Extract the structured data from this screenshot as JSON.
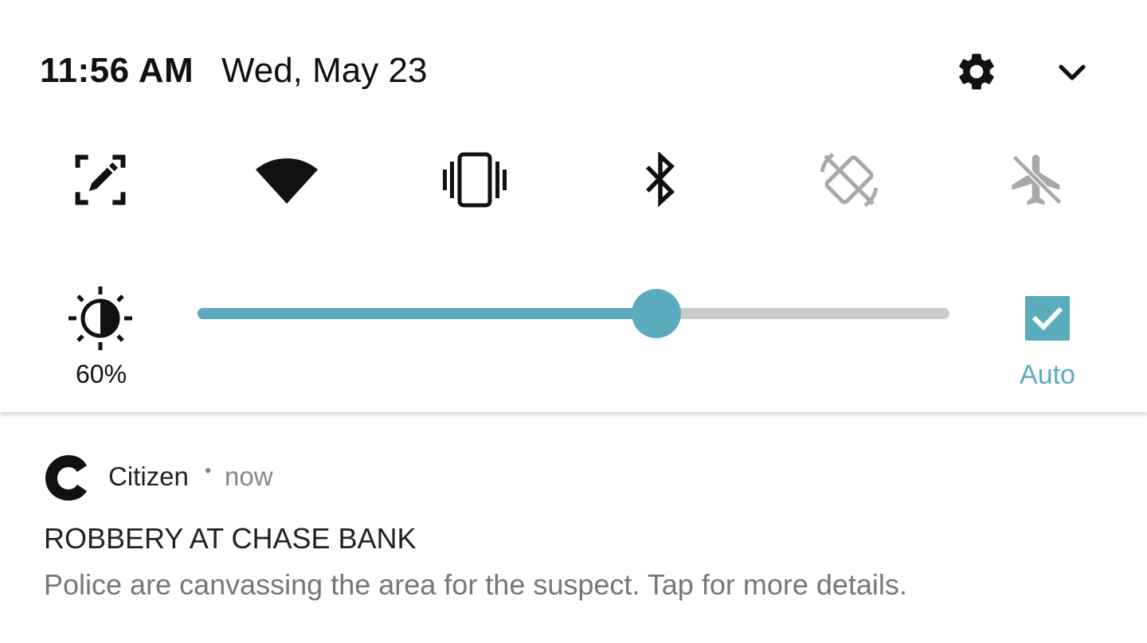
{
  "header": {
    "time": "11:56 AM",
    "date": "Wed, May 23",
    "settings_icon": "gear-icon",
    "expand_icon": "chevron-down-icon"
  },
  "tiles": [
    {
      "icon": "screen-cast-edit-icon",
      "state": "active"
    },
    {
      "icon": "wifi-icon",
      "state": "active"
    },
    {
      "icon": "vibrate-icon",
      "state": "active"
    },
    {
      "icon": "bluetooth-icon",
      "state": "active"
    },
    {
      "icon": "auto-rotate-icon",
      "state": "inactive"
    },
    {
      "icon": "airplane-mode-icon",
      "state": "inactive"
    }
  ],
  "brightness": {
    "icon": "brightness-icon",
    "percent_label": "60%",
    "level": 0.61,
    "auto_label": "Auto",
    "auto_checked": true
  },
  "notification": {
    "app_icon": "citizen-logo-icon",
    "app_name": "Citizen",
    "separator": "•",
    "time": "now",
    "title": "ROBBERY AT CHASE BANK",
    "body": "Police are canvassing the area for the suspect. Tap for more details."
  },
  "colors": {
    "accent": "#5aabbd",
    "icon_active": "#111111",
    "icon_inactive": "#a9a9a9",
    "track": "#cbcbcb"
  }
}
